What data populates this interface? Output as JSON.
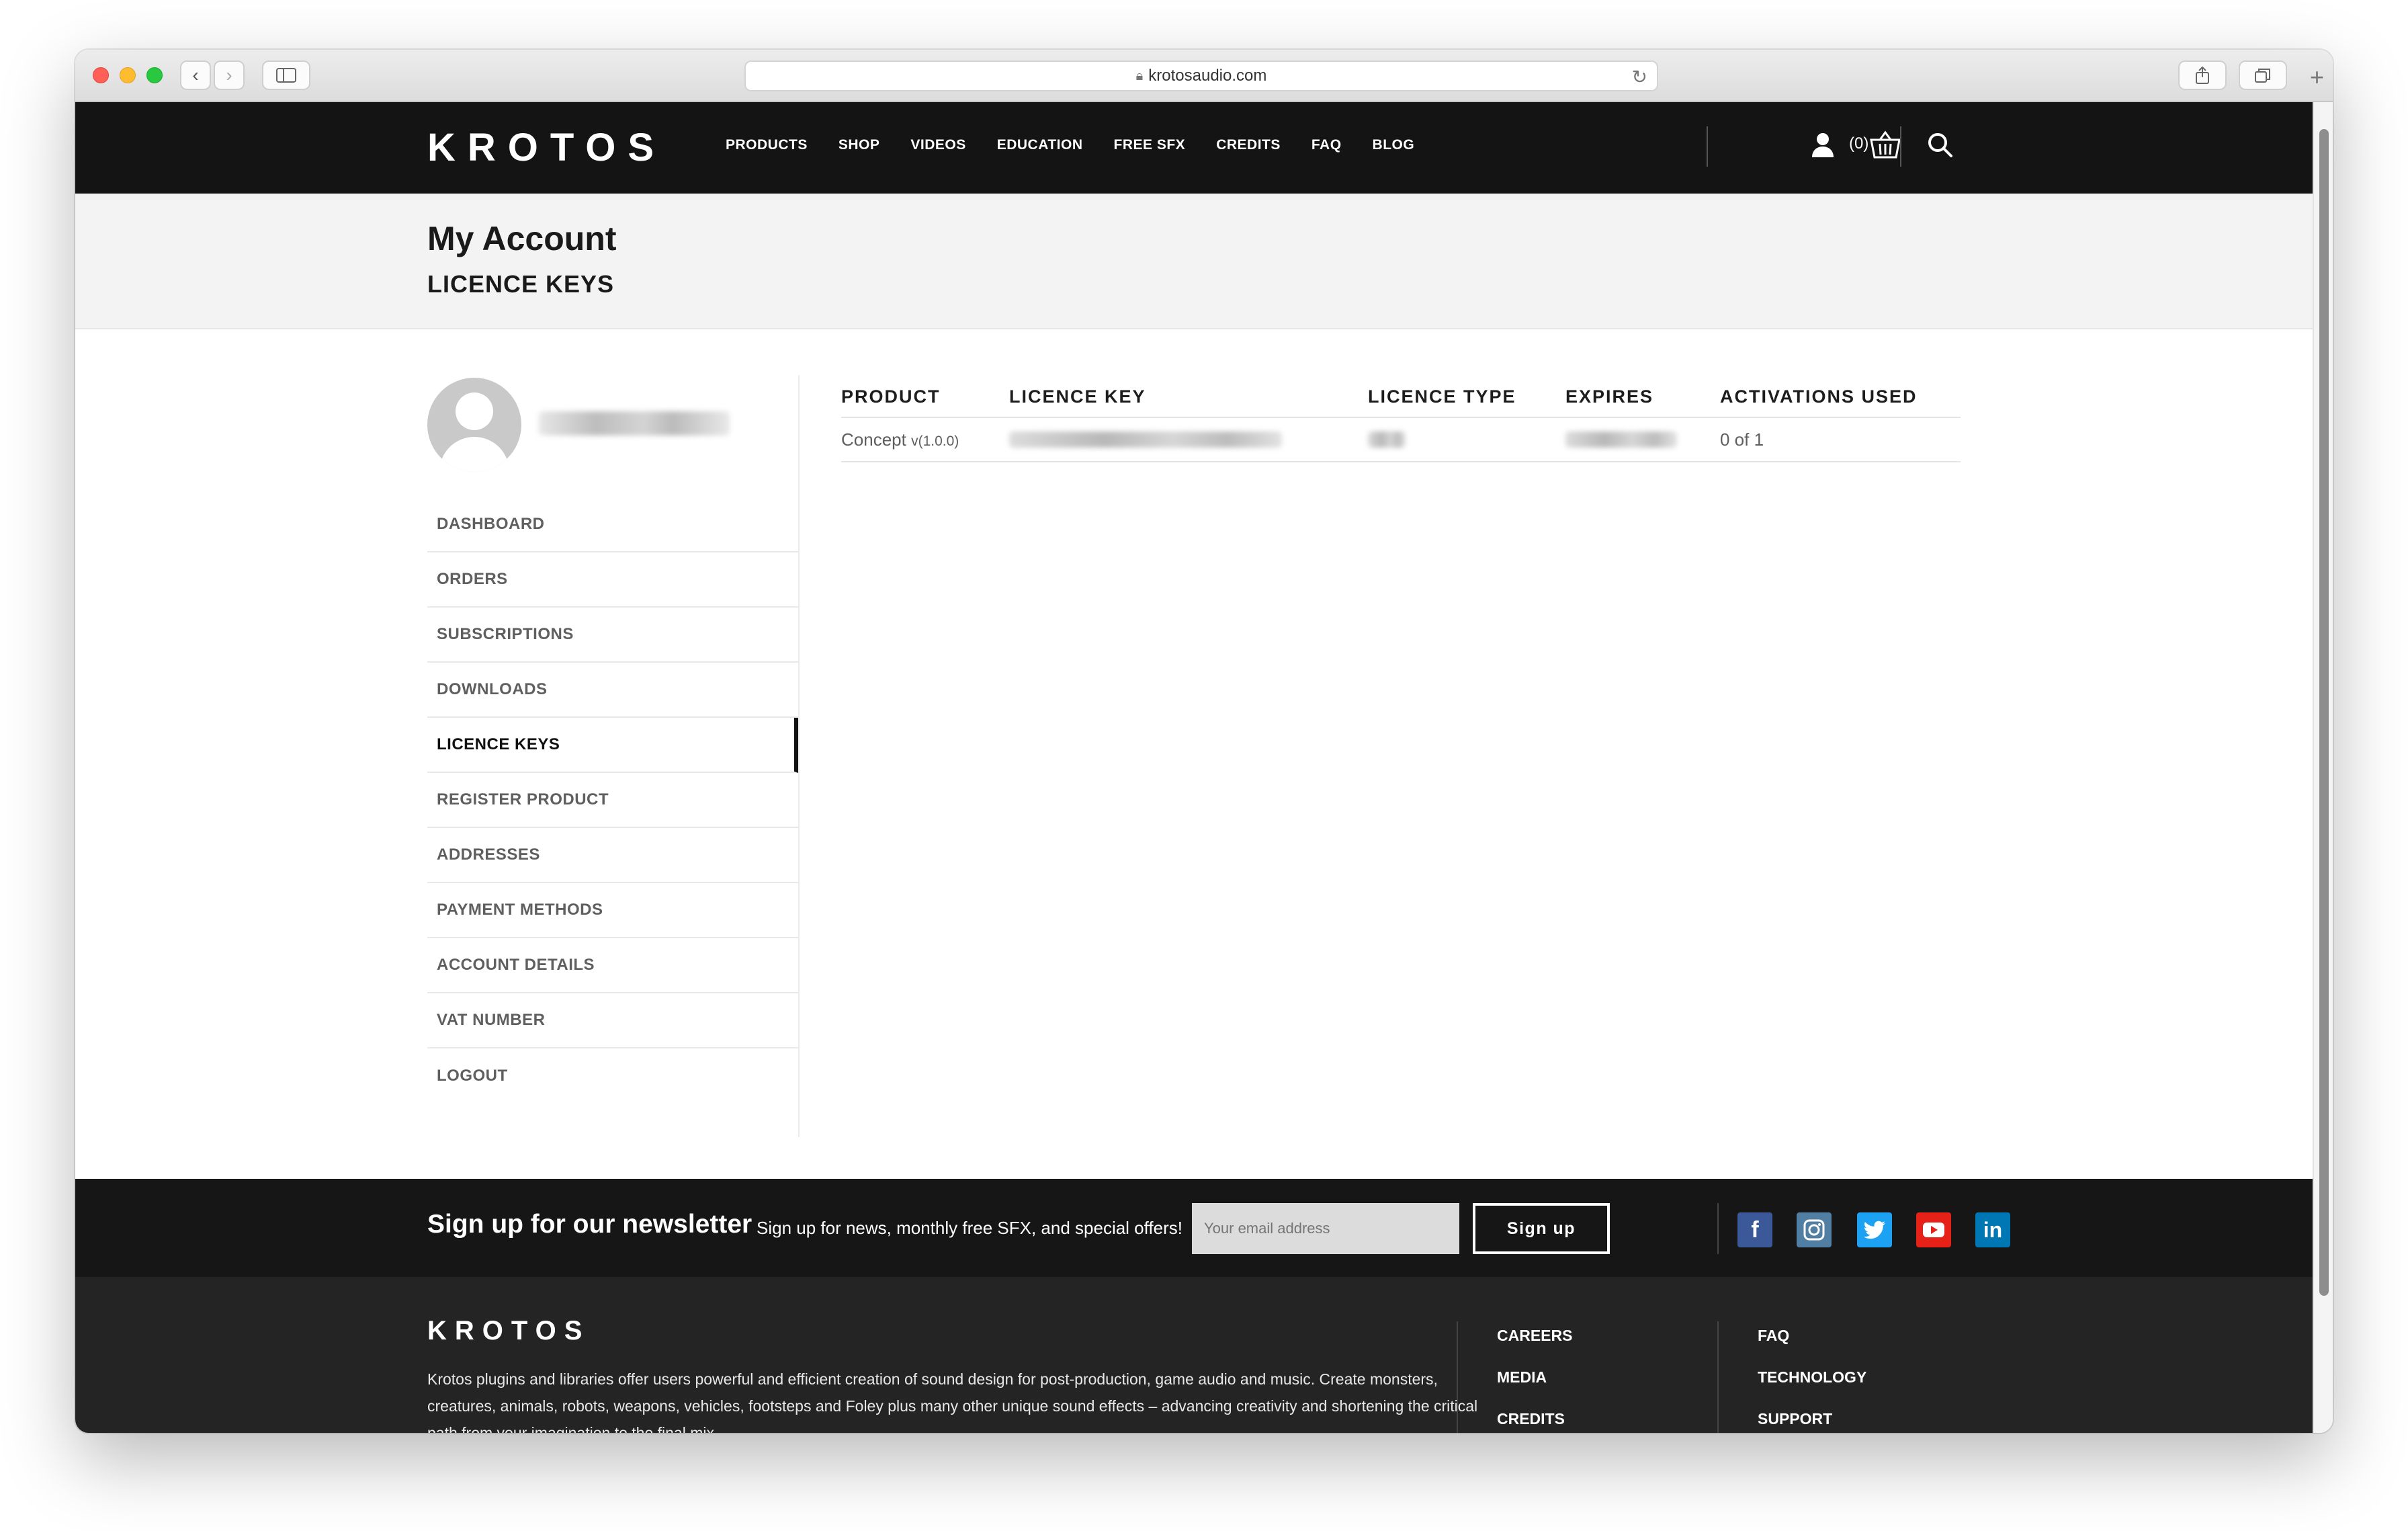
{
  "browser": {
    "url": "krotosaudio.com",
    "icons": {
      "back": "chevron-left-icon",
      "forward": "chevron-right-icon",
      "sidebar": "sidebar-icon",
      "lock": "lock-icon",
      "reload": "reload-icon",
      "share": "share-icon",
      "tabs": "tabs-icon",
      "newtab": "plus-icon"
    }
  },
  "header": {
    "logo": "KROTOS",
    "nav": [
      "PRODUCTS",
      "SHOP",
      "VIDEOS",
      "EDUCATION",
      "FREE SFX",
      "CREDITS",
      "FAQ",
      "BLOG"
    ],
    "cart_count": "(0)"
  },
  "page": {
    "title": "My Account",
    "subtitle": "LICENCE KEYS"
  },
  "sidebar": {
    "items": [
      {
        "label": "DASHBOARD",
        "active": false
      },
      {
        "label": "ORDERS",
        "active": false
      },
      {
        "label": "SUBSCRIPTIONS",
        "active": false
      },
      {
        "label": "DOWNLOADS",
        "active": false
      },
      {
        "label": "LICENCE KEYS",
        "active": true
      },
      {
        "label": "REGISTER PRODUCT",
        "active": false
      },
      {
        "label": "ADDRESSES",
        "active": false
      },
      {
        "label": "PAYMENT METHODS",
        "active": false
      },
      {
        "label": "ACCOUNT DETAILS",
        "active": false
      },
      {
        "label": "VAT NUMBER",
        "active": false
      },
      {
        "label": "LOGOUT",
        "active": false
      }
    ]
  },
  "table": {
    "headers": [
      "PRODUCT",
      "LICENCE KEY",
      "LICENCE TYPE",
      "EXPIRES",
      "ACTIVATIONS USED"
    ],
    "rows": [
      {
        "product": "Concept",
        "version": "v(1.0.0)",
        "activations": "0 of 1"
      }
    ]
  },
  "newsletter": {
    "title": "Sign up for our newsletter",
    "subtitle": "Sign up for news, monthly free SFX, and special offers!",
    "placeholder": "Your email address",
    "button": "Sign up"
  },
  "social": [
    "facebook-icon",
    "instagram-icon",
    "twitter-icon",
    "youtube-icon",
    "linkedin-icon"
  ],
  "footer": {
    "logo": "KROTOS",
    "text": "Krotos plugins and libraries offer users powerful and efficient creation of sound design for post-production, game audio and music. Create monsters, creatures, animals, robots, weapons, vehicles, footsteps and Foley plus many other unique sound effects – advancing creativity and shortening the critical path from your imagination to the final mix.",
    "col1": [
      "CAREERS",
      "MEDIA",
      "CREDITS"
    ],
    "col2": [
      "FAQ",
      "TECHNOLOGY",
      "SUPPORT"
    ]
  },
  "colors": {
    "header_bg": "#141414",
    "footer_bg": "#242424",
    "title_band": "#f3f3f3",
    "facebook": "#3b5998",
    "instagram": "#517fa4",
    "twitter": "#1da1f2",
    "youtube": "#e62117",
    "linkedin": "#0077b5"
  }
}
